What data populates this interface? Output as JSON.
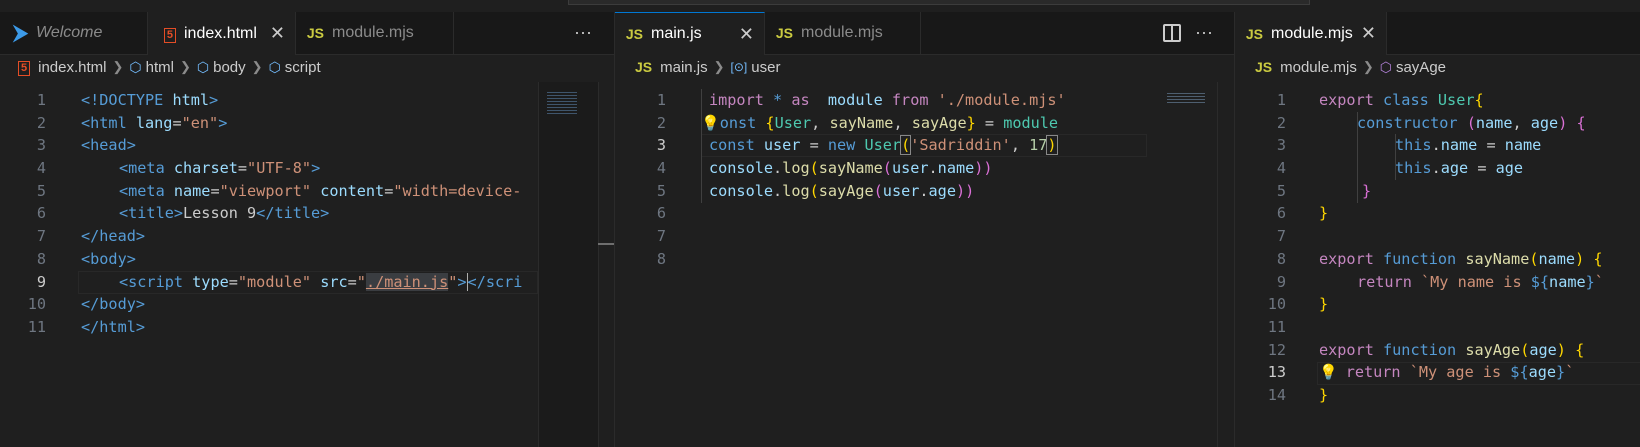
{
  "colors": {
    "accent": "#0078d4",
    "js_icon": "#cbcb41",
    "html_icon": "#e44d26"
  },
  "left": {
    "tabs": [
      {
        "icon": "vscode-icon",
        "label": "Welcome"
      },
      {
        "icon": "html5-icon",
        "label": "index.html"
      },
      {
        "icon": "js-icon",
        "label": "module.mjs"
      }
    ],
    "more": "···",
    "breadcrumb": {
      "file": "index.html",
      "items": [
        "html",
        "body",
        "script"
      ]
    },
    "line_numbers": [
      "1",
      "2",
      "3",
      "4",
      "5",
      "6",
      "7",
      "8",
      "9",
      "10",
      "11"
    ],
    "lines": [
      [
        "<!DOCTYPE ",
        "html",
        ">"
      ],
      [
        "<html ",
        "lang",
        "=",
        "\"en\"",
        ">"
      ],
      [
        "<head>"
      ],
      [
        "<meta ",
        "charset",
        "=",
        "\"UTF-8\"",
        ">"
      ],
      [
        "<meta ",
        "name",
        "=",
        "\"viewport\"",
        " content",
        "=",
        "\"width=device-"
      ],
      [
        "<title>",
        "Lesson 9",
        "</title>"
      ],
      [
        "</head>"
      ],
      [
        "<body>"
      ],
      [
        "<script ",
        "type",
        "=",
        "\"module\"",
        " src",
        "=",
        "\"",
        "./main.js",
        "\"",
        ">",
        "</scri"
      ],
      [
        "</body>"
      ],
      [
        "</html>"
      ]
    ]
  },
  "middle": {
    "tabs": [
      {
        "icon": "js-icon",
        "label": "main.js"
      },
      {
        "icon": "js-icon",
        "label": "module.mjs"
      }
    ],
    "more": "···",
    "breadcrumb": {
      "file": "main.js",
      "symbol": "user"
    },
    "line_numbers": [
      "1",
      "2",
      "3",
      "4",
      "5",
      "6",
      "7",
      "8"
    ],
    "code": {
      "l1": [
        "import",
        " * ",
        "as",
        "  module ",
        "from",
        " './module.mjs'"
      ],
      "l2": [
        "onst",
        " {",
        "User",
        ", ",
        "sayName",
        ", ",
        "sayAge",
        "}",
        " = ",
        "module"
      ],
      "l3": [
        "const",
        " ",
        "user",
        " = ",
        "new",
        " ",
        "User",
        "(",
        "'Sadriddin'",
        ", ",
        "17",
        ")"
      ],
      "l4": [
        "console",
        ".",
        "log",
        "(",
        "sayName",
        "(",
        "user",
        ".",
        "name",
        "))"
      ],
      "l5": [
        "console",
        ".",
        "log",
        "(",
        "sayAge",
        "(",
        "user",
        ".",
        "age",
        "))"
      ]
    }
  },
  "right": {
    "tabs": [
      {
        "icon": "js-icon",
        "label": "module.mjs"
      }
    ],
    "breadcrumb": {
      "file": "module.mjs",
      "symbol": "sayAge"
    },
    "line_numbers": [
      "1",
      "2",
      "3",
      "4",
      "5",
      "6",
      "7",
      "8",
      "9",
      "10",
      "11",
      "12",
      "13",
      "14"
    ],
    "code": {
      "l1": [
        "export",
        " class",
        " ",
        "User",
        "{"
      ],
      "l2": [
        "constructor",
        " (",
        "name",
        ", ",
        "age",
        ") {"
      ],
      "l3": [
        "this",
        ".",
        "name",
        " = ",
        "name"
      ],
      "l4": [
        "this",
        ".",
        "age",
        " = ",
        "age"
      ],
      "l5": [
        "}"
      ],
      "l6": [
        "}"
      ],
      "l8": [
        "export",
        " function",
        " ",
        "sayName",
        "(",
        "name",
        ") {"
      ],
      "l9": [
        "return",
        " `My name is ",
        "${",
        "name",
        "}",
        "`"
      ],
      "l10": [
        "}"
      ],
      "l12": [
        "export",
        " function",
        " ",
        "sayAge",
        "(",
        "age",
        ") {"
      ],
      "l13": [
        "return",
        " `My age is ",
        "${",
        "age",
        "}",
        "`"
      ],
      "l14": [
        "}"
      ]
    }
  }
}
